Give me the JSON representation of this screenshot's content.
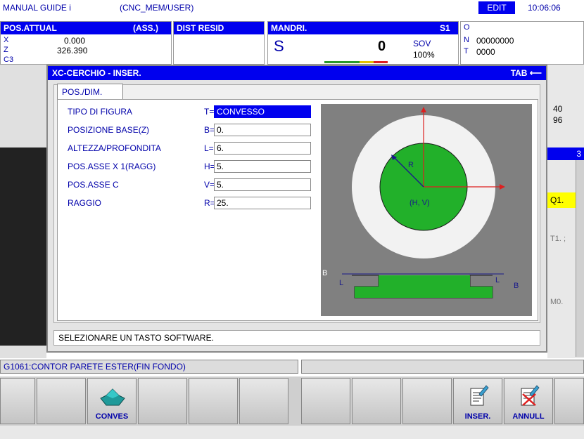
{
  "topbar": {
    "mode": "MANUAL GUIDE i",
    "path": "(CNC_MEM/USER)",
    "edit": "EDIT",
    "time": "10:06:06"
  },
  "pos_panel": {
    "title": "POS.ATTUAL",
    "mode": "(ASS.)",
    "dist_title": "DIST RESID",
    "axes": [
      {
        "name": "X",
        "value": "0.000"
      },
      {
        "name": "Z",
        "value": "326.390"
      },
      {
        "name": "C3",
        "value": ""
      },
      {
        "name": "C",
        "value": ""
      }
    ]
  },
  "spindle_panel": {
    "title": "MANDRI.",
    "s_num": "S1",
    "s_label": "S",
    "s_value": "0",
    "sov_label": "SOV",
    "sov_value": "100%"
  },
  "prog_panel": {
    "o_label": "O",
    "n_label": "N",
    "n_value": "00000000",
    "t_label": "T",
    "t_value": "0000"
  },
  "side_values": {
    "v1": "40",
    "v2": "96",
    "v3": "3",
    "q1": "Q1.",
    "t1": "T1. ;",
    "m0": "M0."
  },
  "dialog": {
    "title": "XC-CERCHIO - INSER.",
    "tab_hint": "TAB ⟵",
    "tab": "POS./DIM.",
    "rows": [
      {
        "label": "TIPO DI FIGURA",
        "letter": "T=",
        "value": "CONVESSO"
      },
      {
        "label": "POSIZIONE BASE(Z)",
        "letter": "B=",
        "value": "0."
      },
      {
        "label": "ALTEZZA/PROFONDITA",
        "letter": "L=",
        "value": "6."
      },
      {
        "label": "POS.ASSE X 1(RAGG)",
        "letter": "H=",
        "value": "5."
      },
      {
        "label": "POS.ASSE C",
        "letter": "V=",
        "value": "5."
      },
      {
        "label": "RAGGIO",
        "letter": "R=",
        "value": "25."
      }
    ],
    "diagram": {
      "r_label": "R",
      "hv_label": "(H, V)",
      "b_label_left": "B",
      "l_label_left": "L",
      "l_label_right": "L",
      "b_label_right": "B"
    },
    "status": "SELEZIONARE UN TASTO SOFTWARE."
  },
  "gcode": "G1061:CONTOR PARETE ESTER(FIN FONDO)",
  "softkeys": [
    {
      "label": "",
      "icon": ""
    },
    {
      "label": "",
      "icon": ""
    },
    {
      "label": "CONVES",
      "icon": "convex-shape-icon"
    },
    {
      "label": "",
      "icon": ""
    },
    {
      "label": "",
      "icon": ""
    },
    {
      "label": "",
      "icon": ""
    },
    {
      "label": "",
      "icon": ""
    },
    {
      "label": "",
      "icon": ""
    },
    {
      "label": "",
      "icon": ""
    },
    {
      "label": "INSER.",
      "icon": "insert-document-icon"
    },
    {
      "label": "ANNULL",
      "icon": "cancel-document-icon"
    },
    {
      "label": "",
      "icon": ""
    }
  ]
}
